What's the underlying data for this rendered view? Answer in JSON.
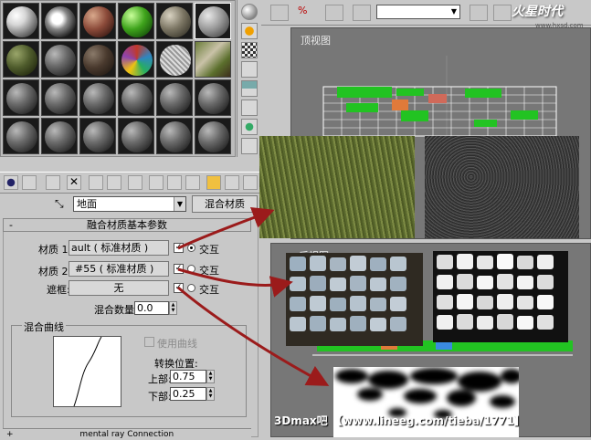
{
  "name_row": {
    "material_name": "地面",
    "material_type": "混合材质"
  },
  "rollout": {
    "title": "融合材质基本参数"
  },
  "material1": {
    "label": "材质 1:",
    "value": "ault  ( 标准材质 )",
    "interactive_label": "交互"
  },
  "material2": {
    "label": "材质 2:",
    "value": "#55  ( 标准材质 )",
    "interactive_label": "交互"
  },
  "mask": {
    "label": "遮框:",
    "value": "无",
    "interactive_label": "交互"
  },
  "mix_amount": {
    "label": "混合数量:",
    "value": "0.0"
  },
  "mix_curve": {
    "group_label": "混合曲线",
    "use_curve_label": "使用曲线",
    "transition_label": "转换位置:",
    "upper_label": "上部:",
    "upper_value": "0.75",
    "lower_label": "下部:",
    "lower_value": "0.25"
  },
  "bottom_rollout": {
    "label": "mental ray Connection"
  },
  "viewports": {
    "top_label": "顶视图",
    "front_label": "后视图"
  },
  "watermark": "3Dmax吧  【www.lineeg.com/tieba/1771】",
  "brand_logo": {
    "text": "火星时代",
    "sub": "www.hxsd.com"
  },
  "colors": {
    "arrow": "#9b1b1b",
    "panel_bg": "#c8c8c8",
    "grid_green": "#22c322"
  },
  "icons": [
    "sphere-icon",
    "checker-icon",
    "cube-icon",
    "pick-icon",
    "delete-icon",
    "reset-icon",
    "show-map-icon",
    "go-parent-icon"
  ]
}
